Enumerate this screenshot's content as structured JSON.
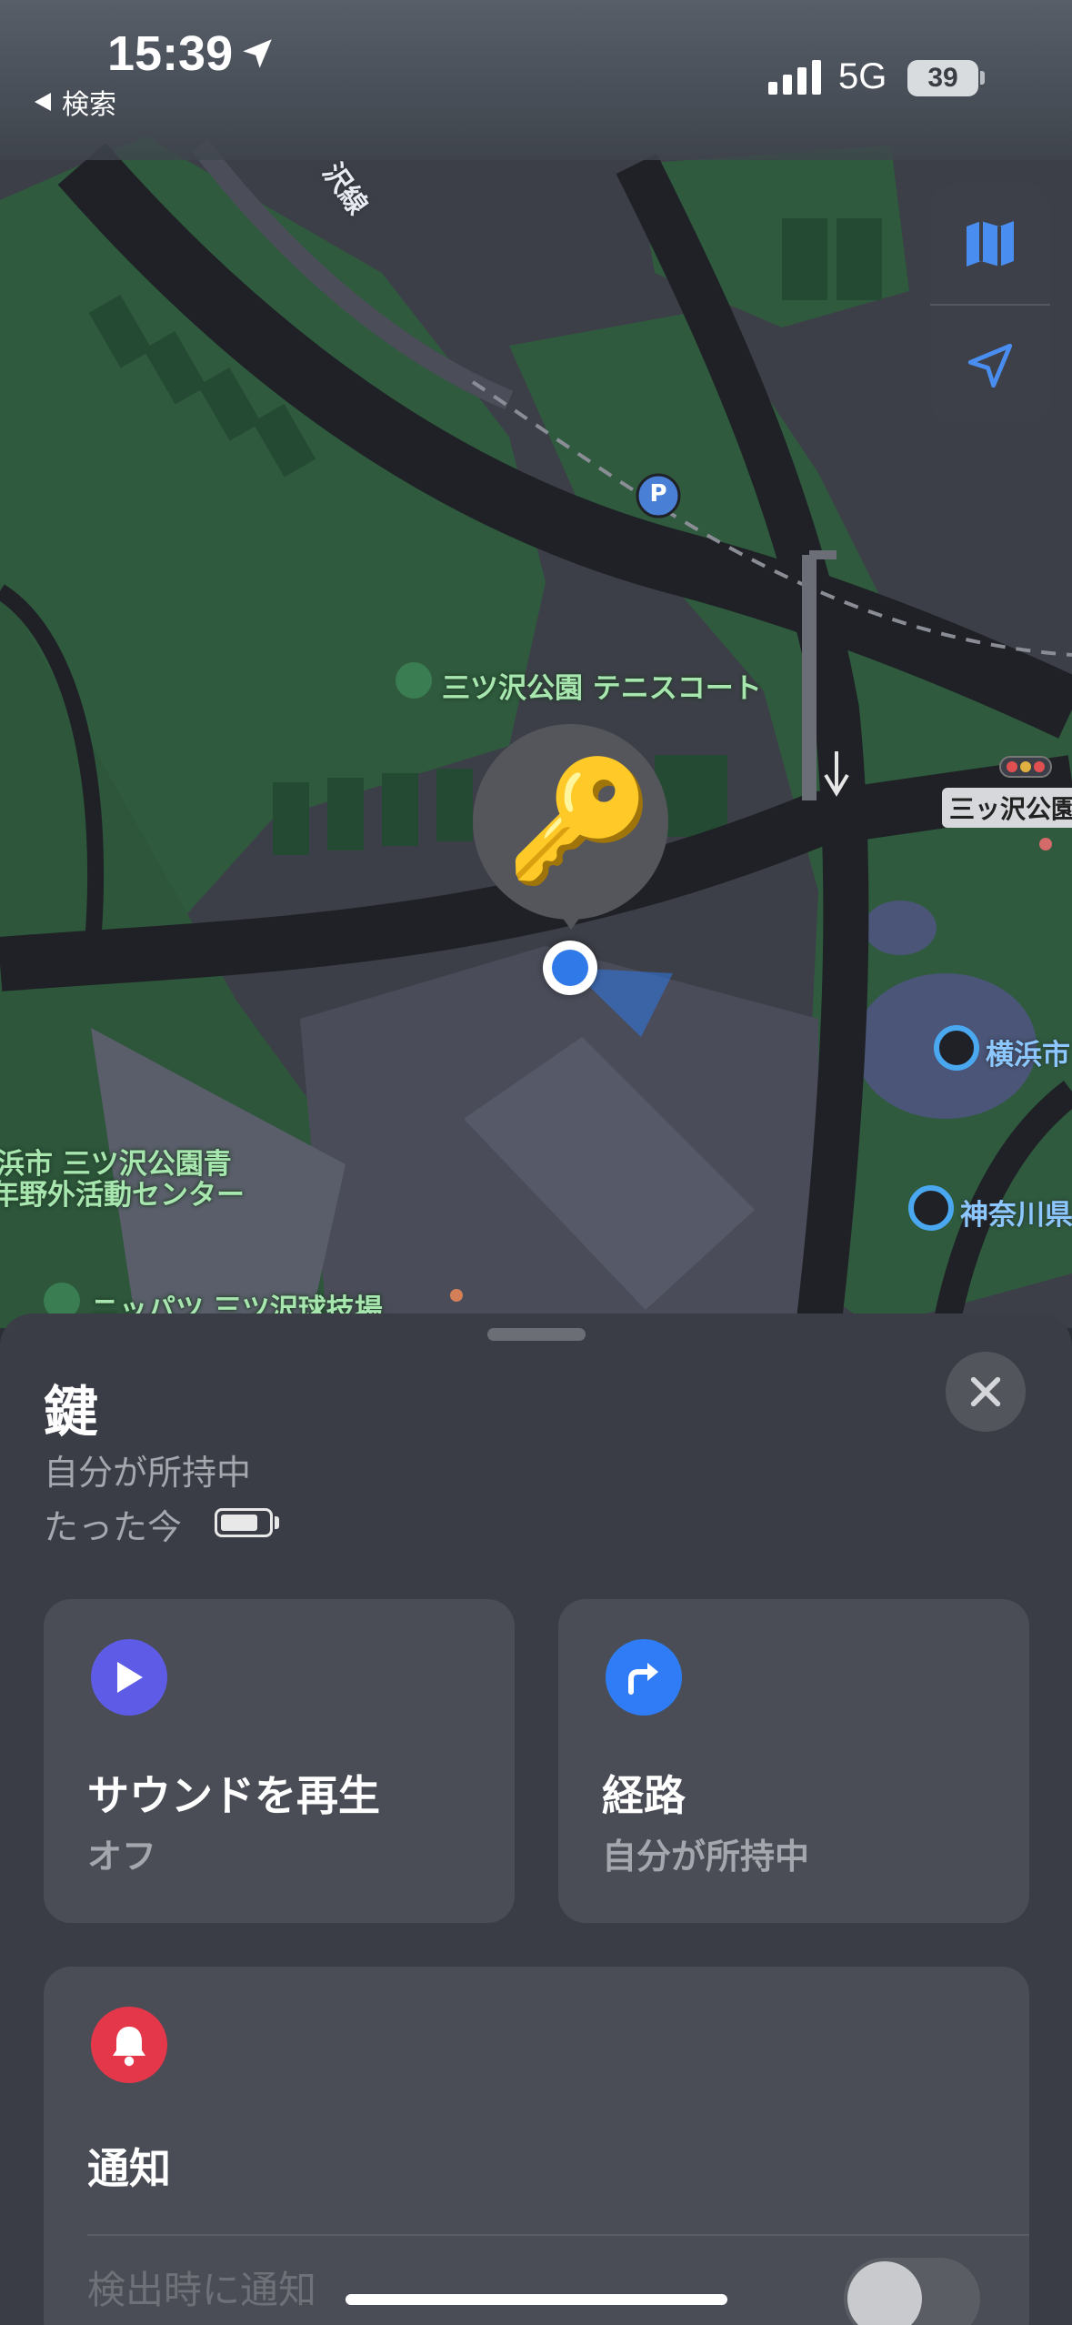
{
  "status_bar": {
    "time": "15:39",
    "back_label": "検索",
    "network": "5G",
    "battery_level": "39"
  },
  "map": {
    "labels": {
      "rail_line": "沢線",
      "tennis_court": "三ツ沢公園 テニスコート",
      "park_tag": "三ッ沢公園",
      "youth_center_1": "浜市 三ツ沢公園青",
      "youth_center_2": "年野外活動センター",
      "ballpark": "ニッパツ 三ツ沢球技場",
      "yokohama": "横浜市",
      "kanagawa": "神奈川県",
      "parking": "P"
    },
    "colors": {
      "park": "#2f5a3e",
      "road": "#1f2126",
      "building": "#5a5e6a",
      "water": "#4a5577"
    }
  },
  "controls": {
    "map_mode_icon": "map-icon",
    "locate_icon": "location-arrow-icon"
  },
  "item": {
    "emoji": "🔑",
    "name": "鍵",
    "owner_status": "自分が所持中",
    "updated": "たった今"
  },
  "actions": {
    "sound": {
      "title": "サウンドを再生",
      "subtitle": "オフ",
      "color": "#5e5ce6"
    },
    "route": {
      "title": "経路",
      "subtitle": "自分が所持中",
      "color": "#2f7cf6"
    },
    "notify": {
      "title": "通知",
      "row_label": "検出時に通知",
      "color": "#e5374a",
      "toggle_on": false
    }
  }
}
